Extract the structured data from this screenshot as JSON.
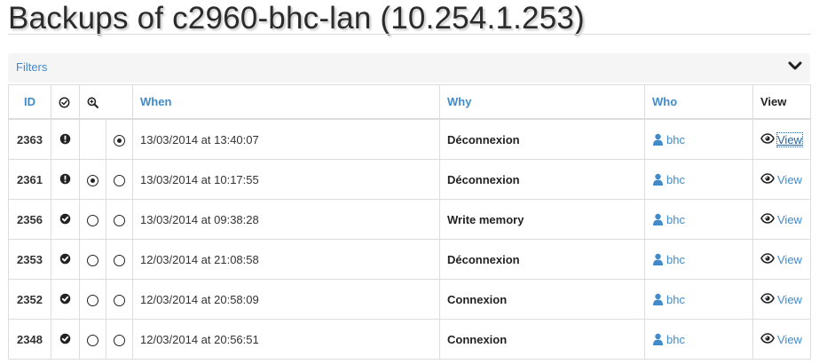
{
  "page": {
    "title": "Backups of c2960-bhc-lan (10.254.1.253)"
  },
  "filters": {
    "label": "Filters",
    "toggle_icon": "chevron-down-icon"
  },
  "table": {
    "headers": {
      "id": "ID",
      "status_icon": "check-circle-icon",
      "compare_icon": "zoom-in-icon",
      "when": "When",
      "why": "Why",
      "who": "Who",
      "view": "View"
    },
    "rows": [
      {
        "id": "2363",
        "status": "warning",
        "left_radio": "none",
        "right_radio": "checked",
        "when": "13/03/2014 at 13:40:07",
        "why": "Déconnexion",
        "who": "bhc",
        "view": "View"
      },
      {
        "id": "2361",
        "status": "warning",
        "left_radio": "checked",
        "right_radio": "unchecked",
        "when": "13/03/2014 at 10:17:55",
        "why": "Déconnexion",
        "who": "bhc",
        "view": "View"
      },
      {
        "id": "2356",
        "status": "ok",
        "left_radio": "unchecked",
        "right_radio": "unchecked",
        "when": "13/03/2014 at 09:38:28",
        "why": "Write memory",
        "who": "bhc",
        "view": "View"
      },
      {
        "id": "2353",
        "status": "ok",
        "left_radio": "unchecked",
        "right_radio": "unchecked",
        "when": "12/03/2014 at 21:08:58",
        "why": "Déconnexion",
        "who": "bhc",
        "view": "View"
      },
      {
        "id": "2352",
        "status": "ok",
        "left_radio": "unchecked",
        "right_radio": "unchecked",
        "when": "12/03/2014 at 20:58:09",
        "why": "Connexion",
        "who": "bhc",
        "view": "View"
      },
      {
        "id": "2348",
        "status": "ok",
        "left_radio": "unchecked",
        "right_radio": "unchecked",
        "when": "12/03/2014 at 20:56:51",
        "why": "Connexion",
        "who": "bhc",
        "view": "View"
      }
    ]
  },
  "colors": {
    "link": "#428bca",
    "text": "#333333",
    "border": "#dddddd",
    "filters_bg": "#f5f5f5"
  }
}
